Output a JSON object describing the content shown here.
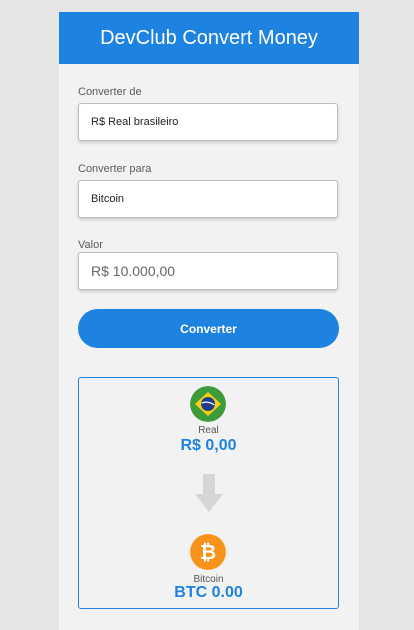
{
  "header": {
    "title": "DevClub Convert Money"
  },
  "form": {
    "from_label": "Converter de",
    "from_value": "R$ Real brasileiro",
    "to_label": "Converter para",
    "to_value": "Bitcoin",
    "amount_label": "Valor",
    "amount_placeholder": "R$ 10.000,00",
    "convert_button": "Converter"
  },
  "result": {
    "from_currency": {
      "name": "Real",
      "value": "R$ 0,00",
      "icon": "brazil-flag-icon"
    },
    "to_currency": {
      "name": "Bitcoin",
      "value": "BTC 0.00",
      "icon": "bitcoin-icon"
    },
    "arrow_icon": "arrow-down-icon"
  },
  "colors": {
    "accent": "#1e82e0",
    "background": "#e6e6e6",
    "card": "#f2f2f2"
  }
}
